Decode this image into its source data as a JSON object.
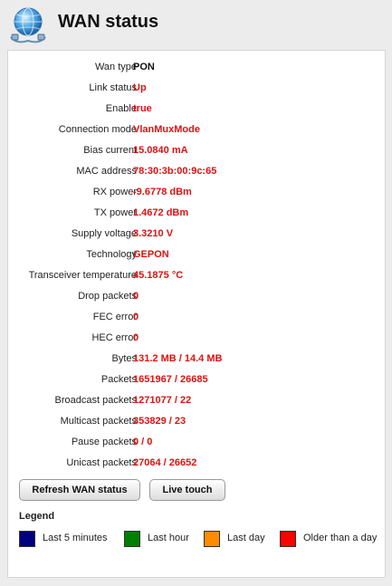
{
  "page": {
    "title": "WAN status"
  },
  "status": [
    {
      "label": "Wan type",
      "value": "PON",
      "color": "black"
    },
    {
      "label": "Link status",
      "value": "Up",
      "color": "red"
    },
    {
      "label": "Enable",
      "value": "true",
      "color": "red"
    },
    {
      "label": "Connection mode",
      "value": "VlanMuxMode",
      "color": "red"
    },
    {
      "label": "Bias current",
      "value": "15.0840 mA",
      "color": "red"
    },
    {
      "label": "MAC address",
      "value": "78:30:3b:00:9c:65",
      "color": "red"
    },
    {
      "label": "RX power",
      "value": "-9.6778 dBm",
      "color": "red"
    },
    {
      "label": "TX power",
      "value": "1.4672 dBm",
      "color": "red"
    },
    {
      "label": "Supply voltage",
      "value": "3.3210 V",
      "color": "red"
    },
    {
      "label": "Technology",
      "value": "GEPON",
      "color": "red"
    },
    {
      "label": "Transceiver temperature",
      "value": "45.1875 °C",
      "color": "red"
    },
    {
      "label": "Drop packets",
      "value": "0",
      "color": "red"
    },
    {
      "label": "FEC error",
      "value": "0",
      "color": "red"
    },
    {
      "label": "HEC error",
      "value": "0",
      "color": "red"
    },
    {
      "label": "Bytes",
      "value": "131.2 MB / 14.4 MB",
      "color": "red"
    },
    {
      "label": "Packets",
      "value": "1651967 / 26685",
      "color": "red"
    },
    {
      "label": "Broadcast packets",
      "value": "1271077 / 22",
      "color": "red"
    },
    {
      "label": "Multicast packets",
      "value": "353829 / 23",
      "color": "red"
    },
    {
      "label": "Pause packets",
      "value": "0 / 0",
      "color": "red"
    },
    {
      "label": "Unicast packets",
      "value": "27064 / 26652",
      "color": "red"
    }
  ],
  "buttons": {
    "refresh": "Refresh WAN status",
    "live": "Live touch"
  },
  "legend": {
    "title": "Legend",
    "items": [
      {
        "label": "Last 5 minutes",
        "color": "#000080"
      },
      {
        "label": "Last hour",
        "color": "#008000"
      },
      {
        "label": "Last day",
        "color": "#ff8c00"
      },
      {
        "label": "Older than a day",
        "color": "#ff0000"
      }
    ]
  },
  "icons": {
    "header": "globe-network-icon"
  }
}
